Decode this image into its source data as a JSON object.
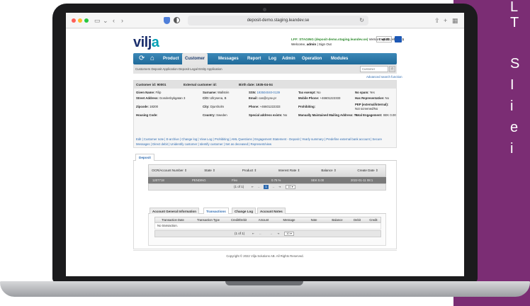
{
  "side_text": [
    "L",
    "T",
    "S",
    "I",
    "i",
    "e",
    "i"
  ],
  "browser": {
    "url": "deposit-demo.staging.leandev.se"
  },
  "header": {
    "logo_text": "vilj",
    "logo_accent": "a",
    "env_label": "LFF: STAGING (deposit-demo.staging.leandev.se)",
    "version_label": "Version:",
    "version": "v6.22.3-build.1",
    "welcome_label": "Welcome,",
    "welcome_user": "admin",
    "sign_out": "| Sign Out",
    "language": "English"
  },
  "nav": {
    "items": [
      "Product",
      "Customer",
      "Messages",
      "Report",
      "Log",
      "Admin",
      "Operation",
      "Modules"
    ],
    "active": "Customer"
  },
  "subnav": {
    "breadcrumb": "Customers  Deposit Application  Deposit Legal Entity Application",
    "search_placeholder": "Customer",
    "advanced_search": "Advanced search function"
  },
  "customer": {
    "header": {
      "id": "Customer id: 90001",
      "external": "External customer id:",
      "birth": "Birth date: 1935-04-04"
    },
    "fields": {
      "given_name": [
        "Given Name:",
        "Filip"
      ],
      "surname": [
        "Surname:",
        "Wallstén"
      ],
      "ssn": [
        "SSN:",
        "193504040-0139"
      ],
      "tax_exempt": [
        "Tax exempt:",
        "No"
      ],
      "no_spam": [
        "No spam:",
        "Yes"
      ],
      "street": [
        "Street Address:",
        "Gondenbykgatan 3"
      ],
      "co": [
        "C/O:",
        "Ullrysena, B"
      ],
      "email": [
        "Email:",
        "cas@cyse.pr"
      ],
      "mobile": [
        "Mobile Phone:",
        "+46601222333"
      ],
      "has_rep": [
        "Has Representative:",
        "No"
      ],
      "zip": [
        "Zipcode:",
        "18200"
      ],
      "city": [
        "City:",
        "Djursholm"
      ],
      "phone": [
        "Phone:",
        "+46601222333"
      ],
      "prohibiting": [
        "Prohibiting:",
        ""
      ],
      "pep": [
        "PEP (external/internal):",
        "Not screened/No"
      ],
      "housing": [
        "Housing Code:",
        ""
      ],
      "country": [
        "Country:",
        "Sweden"
      ],
      "special_addr": [
        "Special address exists:",
        "No"
      ],
      "manual_mail": [
        "Manually Maintained Mailing Address:",
        "No"
      ],
      "total_eng": [
        "Total Engagement:",
        "SEK 0.00"
      ]
    },
    "action_links": "Edit | Customer note | E-archive | Change log | View Log | Prohibiting | AML Questions | Engagement Statement - Deposit | Yearly summary | Predefine external bank account | Secure Messages | Direct debit | Unidentify customer | Identify customer | Set as deceased | Represent/view"
  },
  "deposit": {
    "tab": "Deposit",
    "columns": [
      "OCR/Account Number ⇕",
      "State ⇕",
      "Product ⇕",
      "Interest Rate ⇕",
      "Balance ⇕",
      "Create Date ⇕"
    ],
    "rows": [
      [
        "1207718",
        "PENDING",
        "Flex",
        "0.75 %",
        "SEK 0.00",
        "2022-01-11 08:1"
      ]
    ],
    "pager": {
      "count": "(1 of 1)",
      "first": "⇤",
      "prev": "←",
      "page": "1",
      "next": "→",
      "last": "⇥",
      "size": "10 ▾"
    }
  },
  "details": {
    "tabs": [
      "Account General Information",
      "Transactions",
      "Change Log",
      "Account Notes"
    ],
    "active_tab": "Transactions",
    "columns": [
      "Transaction Date",
      "Transaction Type",
      "Credit/Debit",
      "Amount",
      "Message",
      "Note",
      "Balance",
      "Debit",
      "Credit"
    ],
    "empty": "No transaction.",
    "pager": {
      "count": "(1 of 1)",
      "first": "⇤",
      "prev": "←",
      "next": "→",
      "last": "⇥",
      "size": "10 ▾"
    }
  },
  "footer": {
    "copyright": "Copyright © 2022 Vilja Solutions AB. All Rights Reserved."
  }
}
